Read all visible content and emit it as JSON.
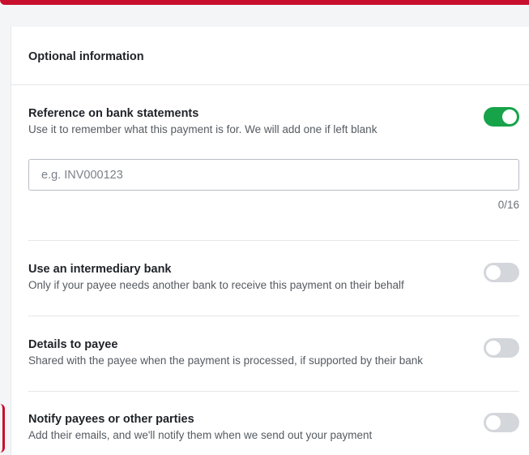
{
  "colors": {
    "accent_red": "#c8102e",
    "toggle_on": "#17a34a",
    "toggle_off": "#d3d6da"
  },
  "panel": {
    "title": "Optional information"
  },
  "reference": {
    "title": "Reference on bank statements",
    "description": "Use it to remember what this payment is for. We will add one if left blank",
    "enabled": true,
    "input_value": "",
    "input_placeholder": "e.g. INV000123",
    "counter": "0/16"
  },
  "intermediary": {
    "title": "Use an intermediary bank",
    "description": "Only if your payee needs another bank to receive this payment on their behalf",
    "enabled": false
  },
  "details": {
    "title": "Details to payee",
    "description": "Shared with the payee when the payment is processed, if supported by their bank",
    "enabled": false
  },
  "notify": {
    "title": "Notify payees or other parties",
    "description": "Add their emails, and we'll notify them when we send out your payment",
    "enabled": false
  }
}
